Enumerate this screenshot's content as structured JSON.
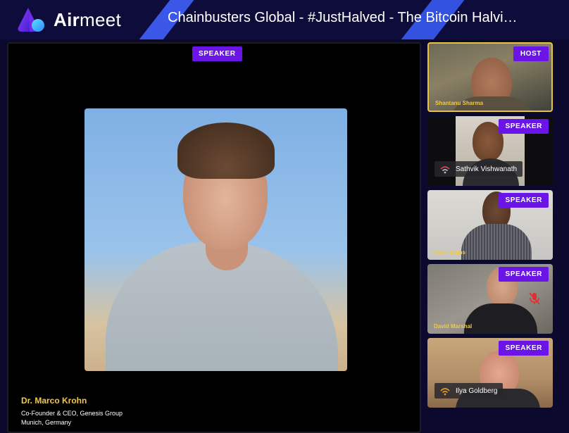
{
  "app": {
    "brand": "Airmeet",
    "brand_part1": "Air",
    "brand_part2": "meet",
    "event_title": "Chainbusters Global - #JustHalved - The Bitcoin Halvi…"
  },
  "stage": {
    "badge": "SPEAKER",
    "speaker": {
      "name": "Dr. Marco Krohn",
      "role": "Co-Founder & CEO, Genesis Group",
      "location": "Munich, Germany"
    }
  },
  "tiles": [
    {
      "badge": "HOST",
      "name": "Shantanu Sharma"
    },
    {
      "badge": "SPEAKER",
      "name": "Sathvik Vishwanath",
      "connection": "wifi-icon"
    },
    {
      "badge": "SPEAKER",
      "name": "Pavel Bains"
    },
    {
      "badge": "SPEAKER",
      "name": "David Marshal",
      "mic": "mic-muted-icon"
    },
    {
      "badge": "SPEAKER",
      "name": "Ilya Goldberg",
      "connection": "wifi-icon"
    }
  ],
  "colors": {
    "accent_purple": "#6a14e8",
    "name_gold": "#f2c84b",
    "host_border": "#e8c43a",
    "header_bg": "#0d0c3a",
    "stripe_blue": "#3a57e8"
  }
}
